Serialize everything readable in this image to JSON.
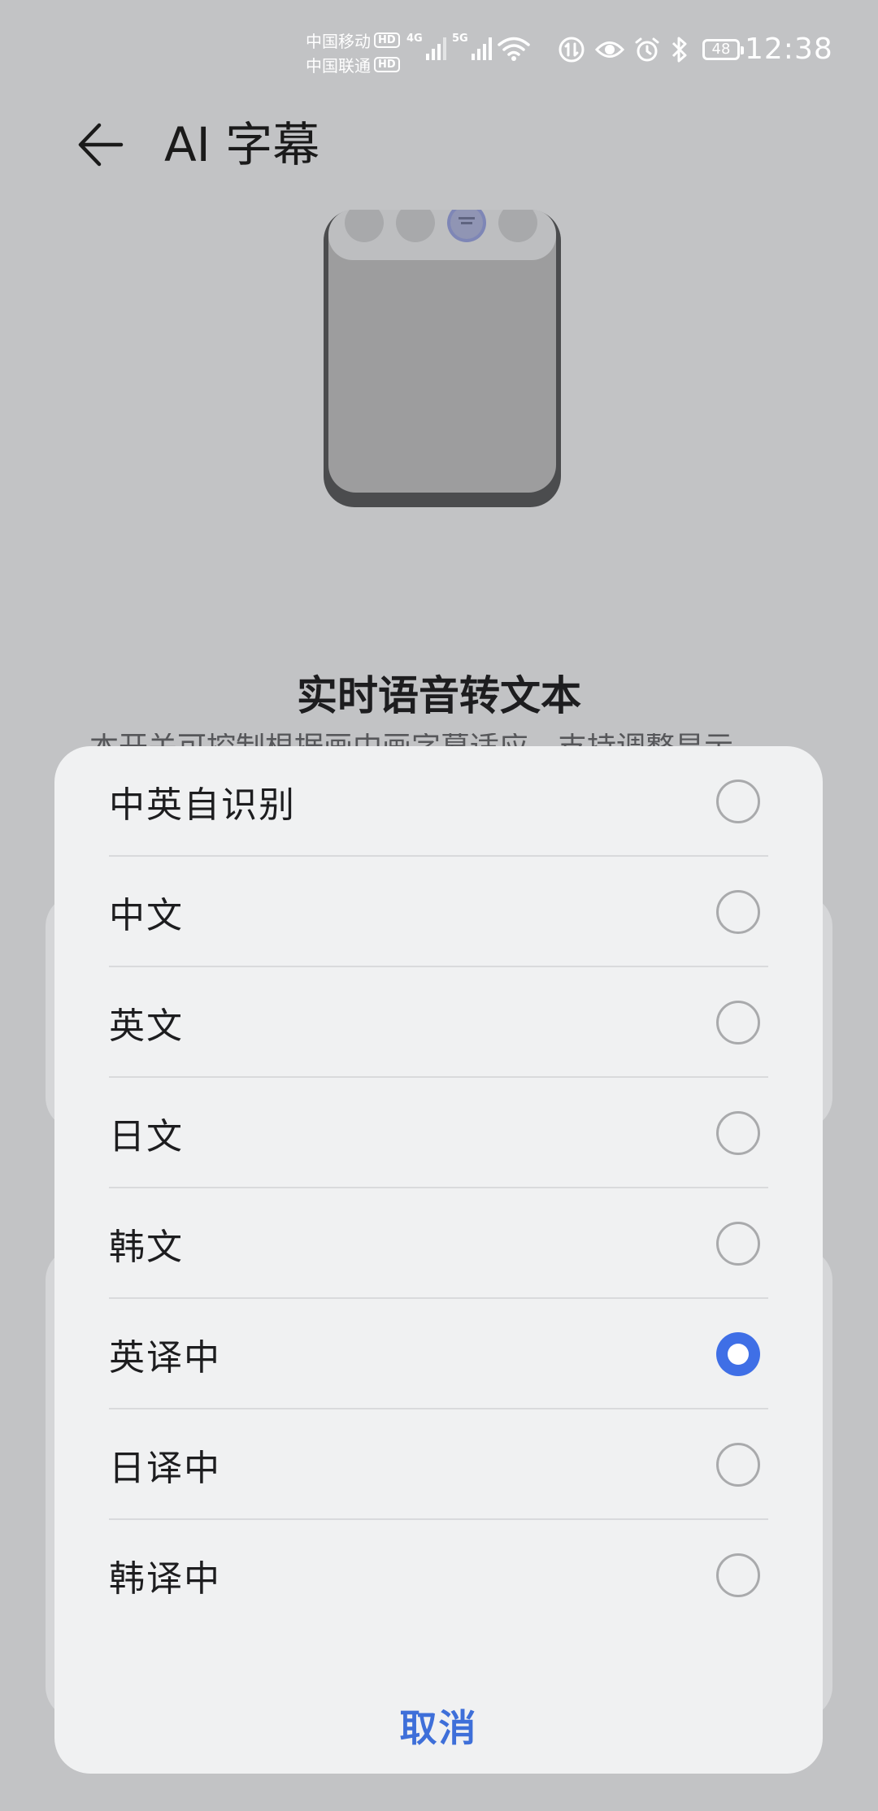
{
  "status_bar": {
    "carrier1": "中国移动",
    "carrier2": "中国联通",
    "hd_label": "HD",
    "sim1_network": "4G",
    "sim2_network": "5G",
    "battery_level": "48",
    "time": "12:38",
    "icons": [
      "signal-icon",
      "wifi-icon",
      "data-saver-icon",
      "eye-comfort-icon",
      "alarm-icon",
      "bluetooth-icon",
      "battery-icon"
    ]
  },
  "app_bar": {
    "title": "AI 字幕"
  },
  "content": {
    "heading": "实时语音转文本",
    "description": "本开关可控制根据画中画字幕适应，支持调整显示"
  },
  "sheet": {
    "options": [
      {
        "label": "中英自识别",
        "selected": false
      },
      {
        "label": "中文",
        "selected": false
      },
      {
        "label": "英文",
        "selected": false
      },
      {
        "label": "日文",
        "selected": false
      },
      {
        "label": "韩文",
        "selected": false
      },
      {
        "label": "英译中",
        "selected": true
      },
      {
        "label": "日译中",
        "selected": false
      },
      {
        "label": "韩译中",
        "selected": false
      }
    ],
    "cancel_label": "取消"
  },
  "colors": {
    "accent": "#3f6fe6",
    "cancel_text": "#3e6fd9",
    "backdrop": "#c2c3c5",
    "sheet_bg": "#f0f1f2"
  }
}
